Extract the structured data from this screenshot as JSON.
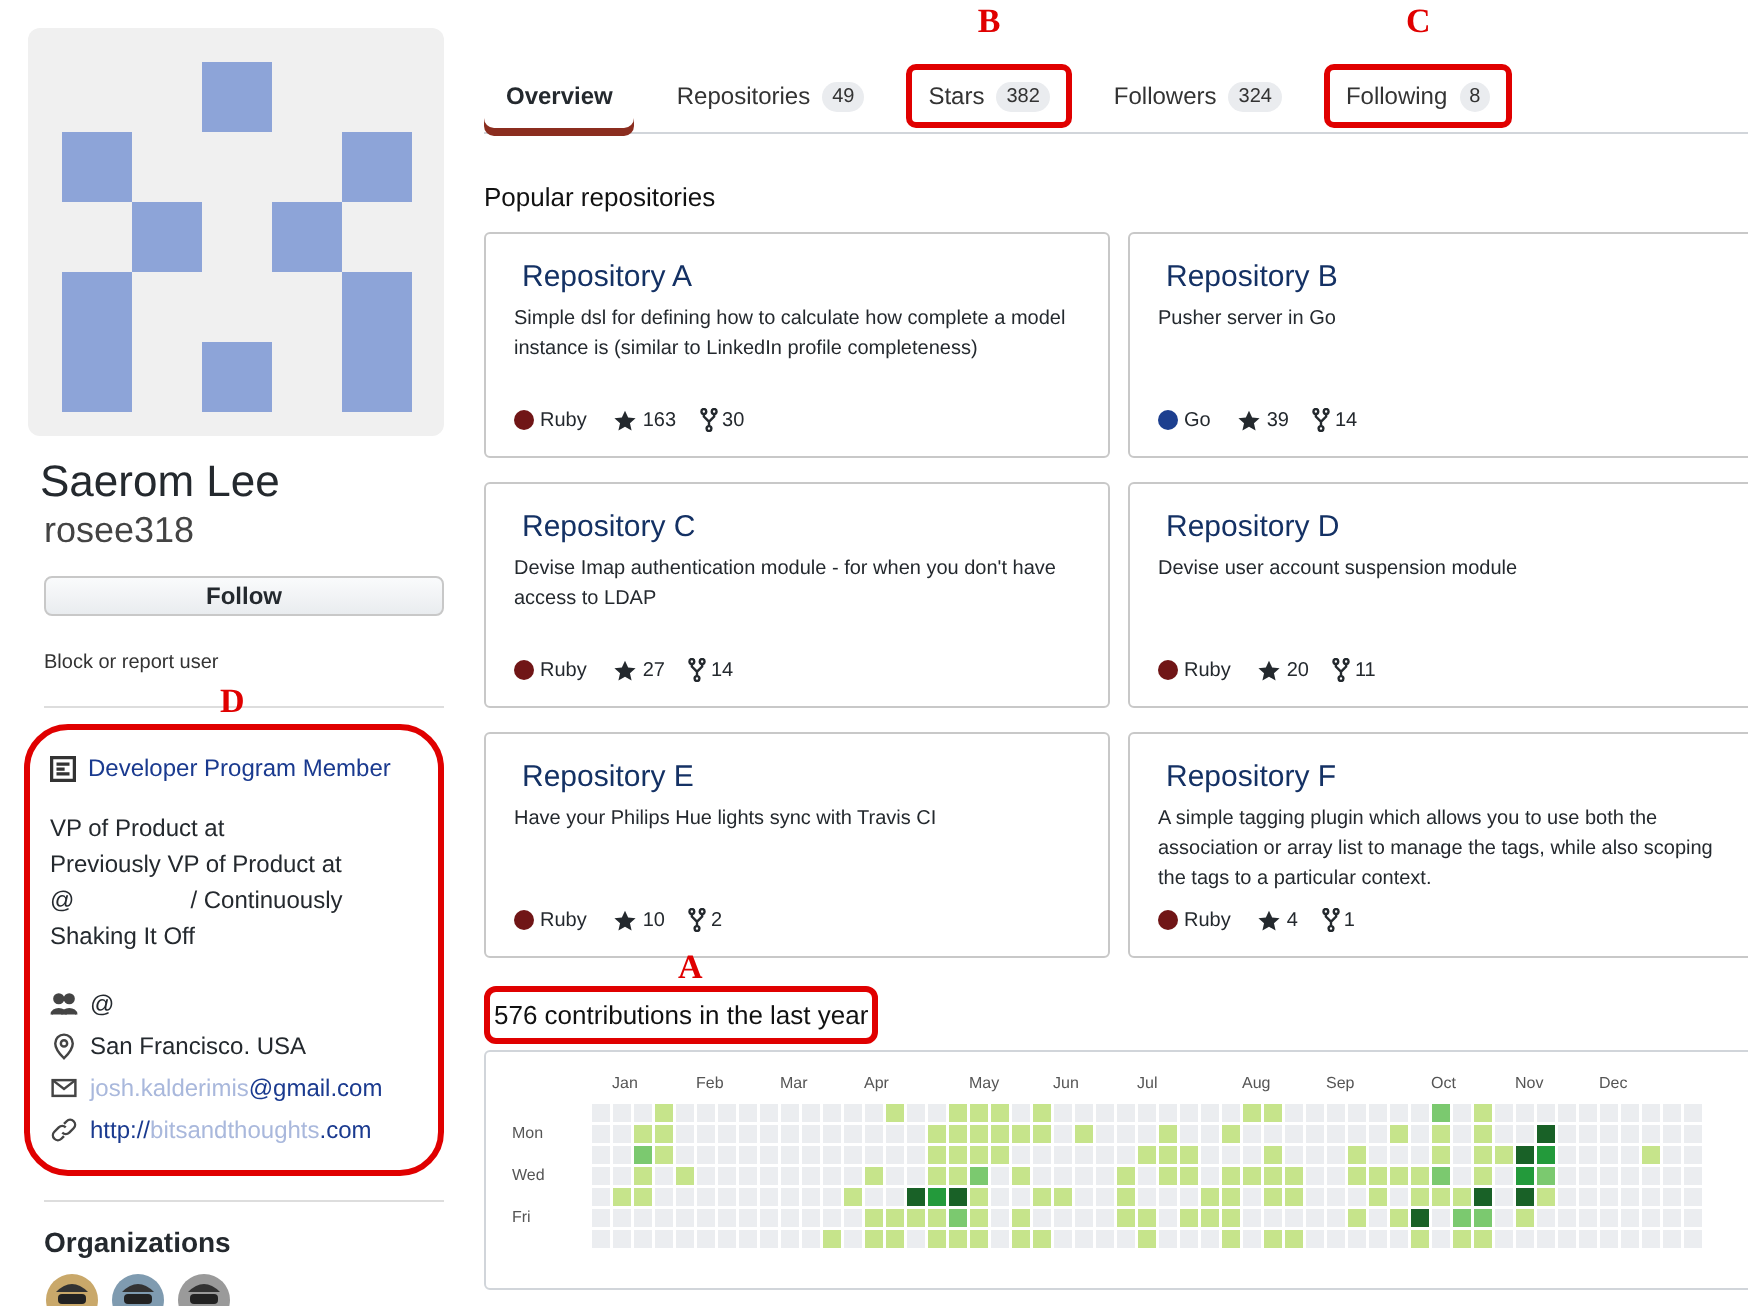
{
  "profile": {
    "name": "Saerom Lee",
    "username": "rosee318",
    "follow_button": "Follow",
    "block_link": "Block or report user",
    "details": {
      "annotation": "D",
      "badge": "Developer Program Member",
      "bio": [
        {
          "text": "VP of Product at"
        },
        {
          "text": "Previously VP of Product at"
        },
        {
          "text": "@",
          "tail": "/ Continuously"
        },
        {
          "text": "Shaking It Off"
        }
      ],
      "items": [
        {
          "kind": "org",
          "text": "@"
        },
        {
          "kind": "location",
          "text": "San Francisco. USA"
        },
        {
          "kind": "email",
          "faded": "josh.kalderimis",
          "text": "@gmail.com"
        },
        {
          "kind": "link",
          "text": "http://",
          "faded": "bitsandthoughts",
          "tail": ".com"
        }
      ]
    },
    "organizations_heading": "Organizations",
    "organizations": [
      {
        "color": "#c9a86a"
      },
      {
        "color": "#7f9bb0"
      },
      {
        "color": "#9a9a9a"
      }
    ]
  },
  "tabs": [
    {
      "label": "Overview",
      "selected": true
    },
    {
      "label": "Repositories",
      "count": "49",
      "selected": false
    },
    {
      "label": "Stars",
      "count": "382",
      "selected": false,
      "annotation": "B"
    },
    {
      "label": "Followers",
      "count": "324",
      "selected": false
    },
    {
      "label": "Following",
      "count": "8",
      "selected": false,
      "annotation": "C"
    }
  ],
  "popular_heading": "Popular repositories",
  "repositories": [
    {
      "name": "Repository A",
      "description": "Simple dsl for defining how to calculate how complete a model instance is (similar to LinkedIn profile completeness)",
      "language": "Ruby",
      "color": "#701516",
      "stars": "163",
      "forks": "30"
    },
    {
      "name": "Repository B",
      "description": "Pusher server in Go",
      "language": "Go",
      "color": "#1d3f8f",
      "stars": "39",
      "forks": "14"
    },
    {
      "name": "Repository C",
      "description": "Devise Imap authentication module - for when you don't have access to LDAP",
      "language": "Ruby",
      "color": "#701516",
      "stars": "27",
      "forks": "14"
    },
    {
      "name": "Repository D",
      "description": "Devise user account suspension module",
      "language": "Ruby",
      "color": "#701516",
      "stars": "20",
      "forks": "11"
    },
    {
      "name": "Repository E",
      "description": "Have your Philips Hue lights sync with Travis CI",
      "language": "Ruby",
      "color": "#701516",
      "stars": "10",
      "forks": "2"
    },
    {
      "name": "Repository F",
      "description": "A simple tagging plugin which allows you to use both the association or array list to manage the tags, while also scoping the tags to a particular context.",
      "language": "Ruby",
      "color": "#701516",
      "stars": "4",
      "forks": "1"
    }
  ],
  "contributions": {
    "heading": "576 contributions in the last year",
    "annotation": "A",
    "months": [
      "Jan",
      "Feb",
      "Mar",
      "Apr",
      "May",
      "Jun",
      "Jul",
      "Aug",
      "Sep",
      "Oct",
      "Nov",
      "Dec"
    ],
    "day_labels": [
      {
        "row": "Mon"
      },
      {
        "row": "Wed"
      },
      {
        "row": "Fri"
      }
    ]
  }
}
